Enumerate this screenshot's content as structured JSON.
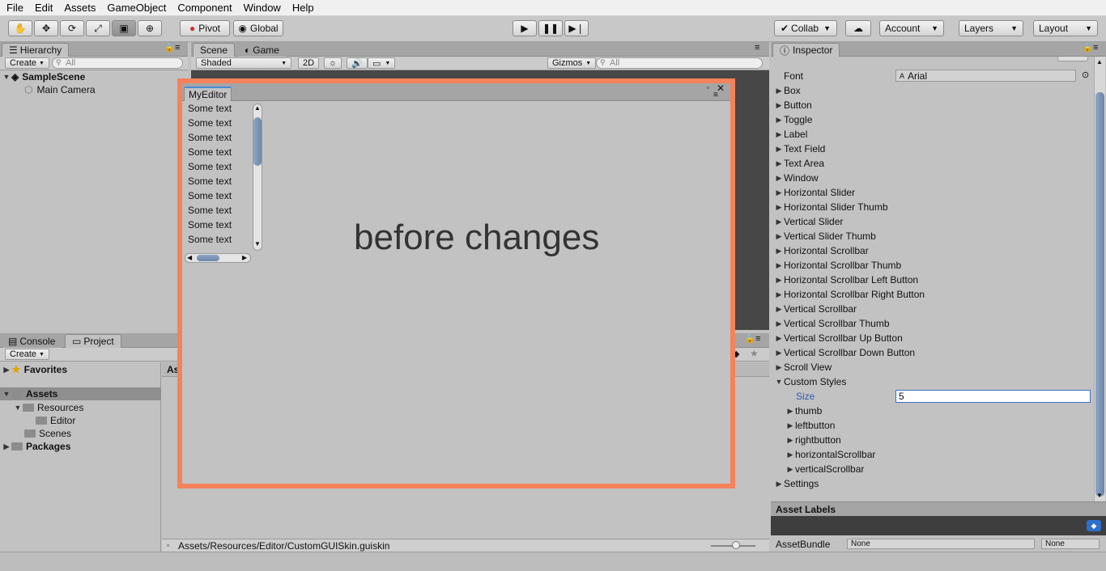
{
  "menu": [
    "File",
    "Edit",
    "Assets",
    "GameObject",
    "Component",
    "Window",
    "Help"
  ],
  "toolbar": {
    "pivot": "Pivot",
    "global": "Global",
    "collab": "Collab",
    "account": "Account",
    "layers": "Layers",
    "layout": "Layout"
  },
  "hierarchy": {
    "tab": "Hierarchy",
    "create": "Create",
    "search_placeholder": "All",
    "scene": "SampleScene",
    "items": [
      "Main Camera"
    ]
  },
  "scene_view": {
    "tabs": [
      "Scene",
      "Game"
    ],
    "shading": "Shaded",
    "mode_2d": "2D",
    "gizmos": "Gizmos",
    "search_placeholder": "All"
  },
  "my_editor": {
    "title": "MyEditor",
    "list_items": [
      "Some text",
      "Some text",
      "Some text",
      "Some text",
      "Some text",
      "Some text",
      "Some text",
      "Some text",
      "Some text",
      "Some text"
    ],
    "big_label": "before changes"
  },
  "project": {
    "tabs": [
      "Console",
      "Project"
    ],
    "create": "Create",
    "favorites": "Favorites",
    "assets": "Assets",
    "resources": "Resources",
    "editor": "Editor",
    "scenes": "Scenes",
    "packages": "Packages",
    "breadcrumb": "Ass",
    "path": "Assets/Resources/Editor/CustomGUISkin.guiskin"
  },
  "inspector": {
    "tab": "Inspector",
    "font_label": "Font",
    "font_value": "Arial",
    "items": [
      "Box",
      "Button",
      "Toggle",
      "Label",
      "Text Field",
      "Text Area",
      "Window",
      "Horizontal Slider",
      "Horizontal Slider Thumb",
      "Vertical Slider",
      "Vertical Slider Thumb",
      "Horizontal Scrollbar",
      "Horizontal Scrollbar Thumb",
      "Horizontal Scrollbar Left Button",
      "Horizontal Scrollbar Right Button",
      "Vertical Scrollbar",
      "Vertical Scrollbar Thumb",
      "Vertical Scrollbar Up Button",
      "Vertical Scrollbar Down Button",
      "Scroll View",
      "Custom Styles"
    ],
    "size_label": "Size",
    "size_value": "5",
    "custom_styles": [
      "thumb",
      "leftbutton",
      "rightbutton",
      "horizontalScrollbar",
      "verticalScrollbar"
    ],
    "settings": "Settings",
    "asset_labels": "Asset Labels",
    "asset_bundle_label": "AssetBundle",
    "asset_bundle_value": "None",
    "asset_bundle_variant": "None"
  },
  "colors": {
    "editor_border": "#f4825a",
    "accent_blue": "#2a5db0",
    "scene_bg": "#474747"
  }
}
